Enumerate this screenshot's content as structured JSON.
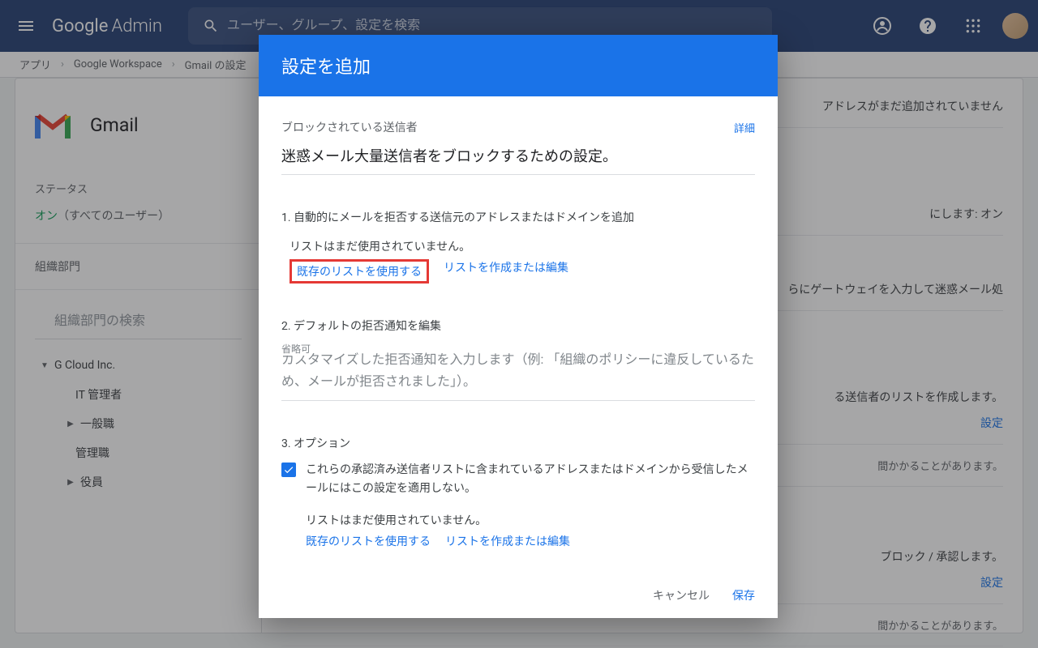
{
  "header": {
    "logo1": "Google",
    "logo2": "Admin",
    "search_placeholder": "ユーザー、グループ、設定を検索"
  },
  "breadcrumb": {
    "items": [
      "アプリ",
      "Google Workspace",
      "Gmail の設定"
    ]
  },
  "sidebar": {
    "gmail_title": "Gmail",
    "status_label": "ステータス",
    "status_on": "オン",
    "status_rest": "（すべてのユーザー）",
    "org_label": "組織部門",
    "org_search": "組織部門の検索",
    "tree": {
      "root": "G Cloud Inc.",
      "items": [
        "IT 管理者",
        "一般職",
        "管理職",
        "役員"
      ]
    }
  },
  "content": {
    "warn": "アドレスがまだ追加されていません",
    "row1": "にします: オン",
    "row2": "らにゲートウェイを入力して迷惑メール処",
    "row3": "る送信者のリストを作成します。",
    "link": "設定",
    "row4": "間かかることがあります。",
    "row5": "ブロック / 承認します。",
    "row6": "間かかることがあります。"
  },
  "modal": {
    "title": "設定を追加",
    "subhead": "ブロックされている送信者",
    "details": "詳細",
    "description": "迷惑メール大量送信者をブロックするための設定。",
    "sec1": {
      "label": "1. 自動的にメールを拒否する送信元のアドレスまたはドメインを追加",
      "nolist": "リストはまだ使用されていません。",
      "link_existing": "既存のリストを使用する",
      "link_create": "リストを作成または編集"
    },
    "sec2": {
      "label": "2. デフォルトの拒否通知を編集",
      "float": "省略可",
      "placeholder": "カスタマイズした拒否通知を入力します（例: 「組織のポリシーに違反しているため、メールが拒否されました」）。"
    },
    "sec3": {
      "label": "3. オプション",
      "cb_label": "これらの承認済み送信者リストに含まれているアドレスまたはドメインから受信したメールにはこの設定を適用しない。",
      "nolist": "リストはまだ使用されていません。",
      "link_existing": "既存のリストを使用する",
      "link_create": "リストを作成または編集"
    },
    "cancel": "キャンセル",
    "save": "保存"
  }
}
